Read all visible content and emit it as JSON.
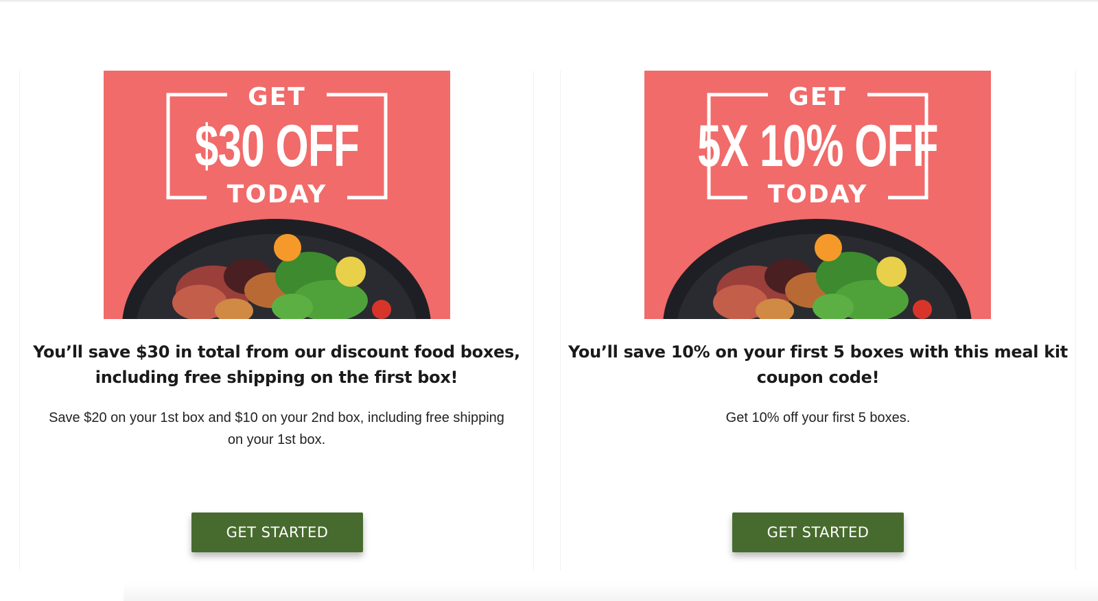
{
  "offers": [
    {
      "banner": {
        "top_text": "GET",
        "main_text": "$30 OFF",
        "bottom_text": "TODAY",
        "background_color": "#f06b6a"
      },
      "headline": "You’ll save $30 in total from our discount food boxes, including free shipping on the first box!",
      "description": "Save $20 on your 1st box and $10 on your 2nd box, including free shipping on your 1st box.",
      "button_label": "GET STARTED"
    },
    {
      "banner": {
        "top_text": "GET",
        "main_text": "5X 10% OFF",
        "bottom_text": "TODAY",
        "background_color": "#f06b6a"
      },
      "headline": "You’ll save 10% on your first 5 boxes with this meal kit coupon code!",
      "description": "Get 10% off your first 5 boxes.",
      "button_label": "GET STARTED"
    }
  ],
  "colors": {
    "button": "#476b2e",
    "banner": "#f06b6a",
    "text": "#1a1a1a"
  }
}
